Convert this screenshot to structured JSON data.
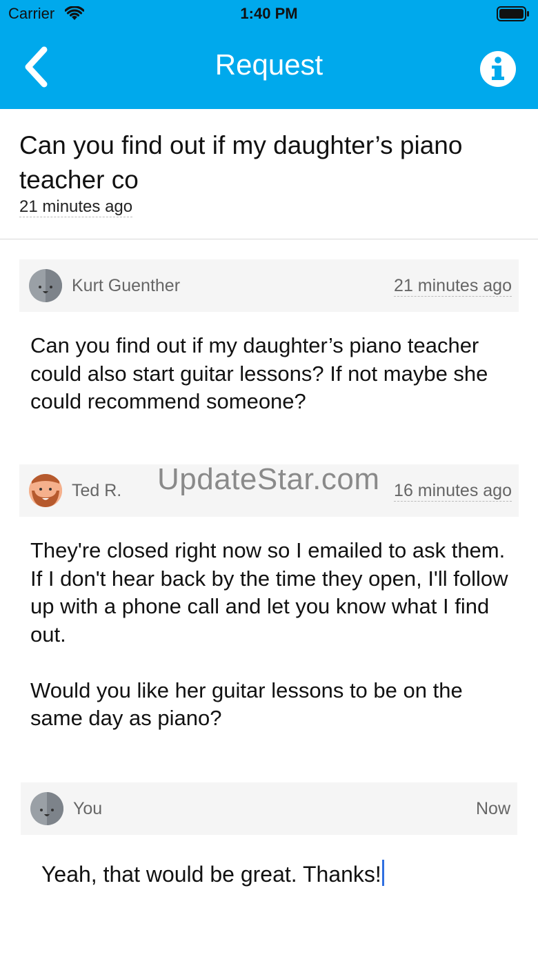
{
  "status_bar": {
    "carrier": "Carrier",
    "time": "1:40 PM"
  },
  "nav": {
    "title": "Request",
    "back_icon": "chevron-left-icon",
    "info_icon": "info-circle-icon",
    "background_color": "#00a9ec"
  },
  "request": {
    "title": "Can you find out if my daughter’s piano teacher co",
    "time": "21 minutes ago"
  },
  "messages": [
    {
      "author": "Kurt Guenther",
      "time": "21 minutes ago",
      "body": "Can you find out if my daughter’s piano teacher could also start guitar lessons? If not maybe she could recommend someone?"
    },
    {
      "author": "Ted R.",
      "time": "16 minutes ago",
      "body": "They're closed right now so I emailed to ask them. If I don't hear back by the time they open, I'll follow up with a phone call and let you know what I find out.\n\nWould you like her guitar lessons to be on the same day as piano?"
    },
    {
      "author": "You",
      "time": "Now"
    }
  ],
  "reply": {
    "value": "Yeah, that would be great. Thanks!"
  },
  "watermark": "UpdateStar.com"
}
